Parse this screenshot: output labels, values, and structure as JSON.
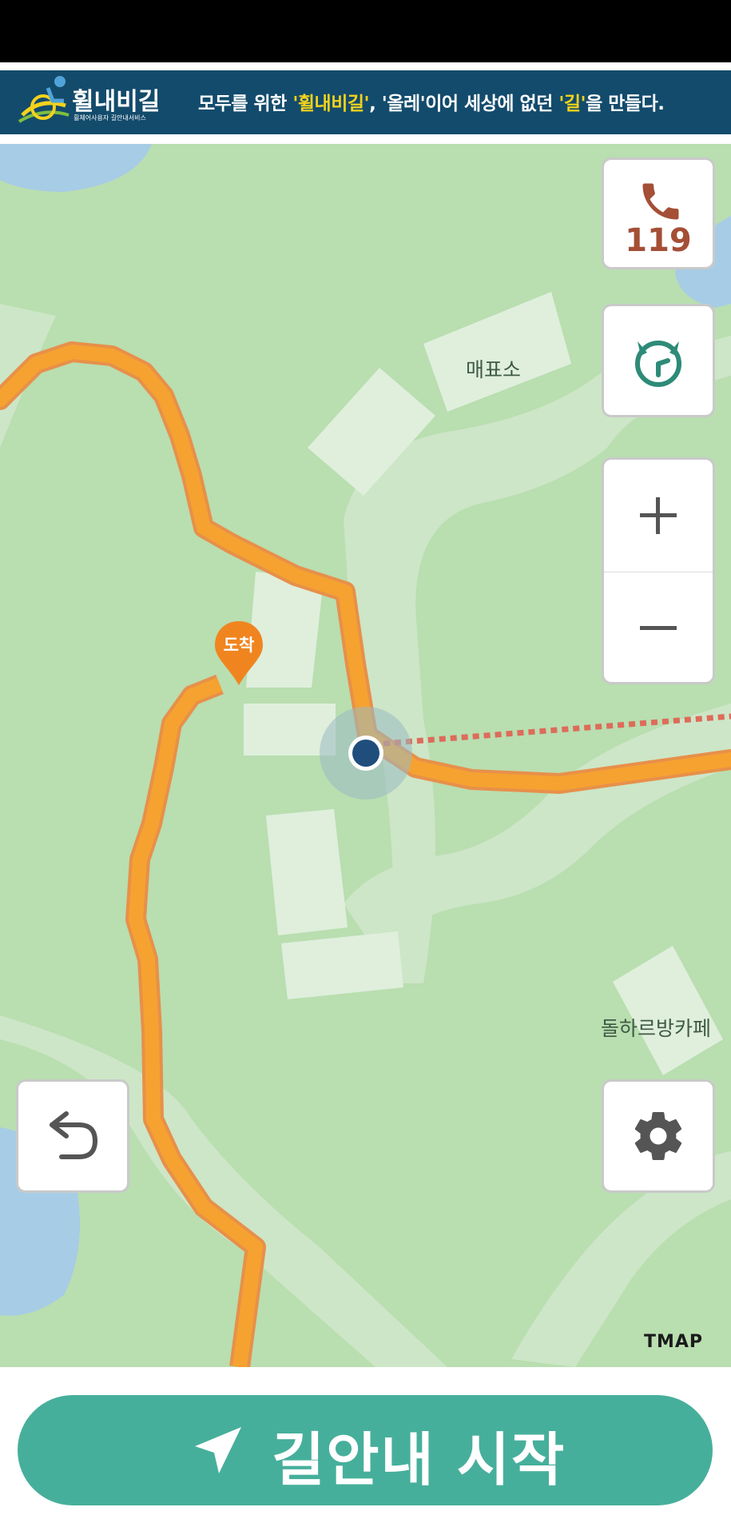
{
  "banner": {
    "logo_title": "휠내비길",
    "logo_subtitle": "휠체어사용자 길안내서비스",
    "slogan": {
      "part1": "모두를 위한 ",
      "highlight1": "'휠내비길'",
      "part2": ", '올레'이어 세상에 없던 ",
      "highlight2": "'길'",
      "part3": "을 만들다."
    }
  },
  "map": {
    "labels": {
      "ticket_office": "매표소",
      "cafe": "돌하르방카페"
    },
    "destination_label": "도착",
    "attribution": "TMAP"
  },
  "controls": {
    "emergency_number": "119"
  },
  "start_button": {
    "label": "길안내 시작"
  },
  "icons": {
    "phone": "phone-icon",
    "compass": "compass-icon",
    "zoom_in": "plus-icon",
    "zoom_out": "minus-icon",
    "back": "undo-arrow-icon",
    "settings": "gear-icon",
    "navigate": "navigation-arrow-icon"
  },
  "colors": {
    "banner_bg": "#134b6c",
    "highlight": "#f3d21c",
    "route": "#f5a231",
    "start_button": "#46af9b",
    "emergency_red": "#a44f36"
  }
}
